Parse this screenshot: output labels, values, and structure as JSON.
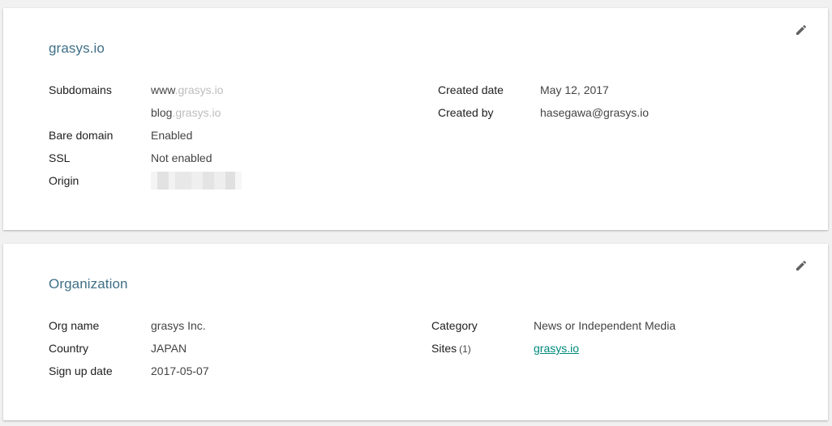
{
  "site": {
    "title": "grasys.io",
    "labels": {
      "subdomains": "Subdomains",
      "bare_domain": "Bare domain",
      "ssl": "SSL",
      "origin": "Origin",
      "created_date": "Created date",
      "created_by": "Created by"
    },
    "subdomains": [
      {
        "prefix": "www",
        "domain": ".grasys.io"
      },
      {
        "prefix": "blog",
        "domain": ".grasys.io"
      }
    ],
    "bare_domain": "Enabled",
    "ssl": "Not enabled",
    "created_date": "May 12, 2017",
    "created_by": "hasegawa@grasys.io"
  },
  "org": {
    "title": "Organization",
    "labels": {
      "org_name": "Org name",
      "country": "Country",
      "sign_up_date": "Sign up date",
      "category": "Category",
      "sites": "Sites"
    },
    "org_name": "grasys Inc.",
    "country": "JAPAN",
    "sign_up_date": "2017-05-07",
    "category": "News or Independent Media",
    "sites_count": "(1)",
    "sites_link": "grasys.io"
  },
  "icons": {
    "edit": "pencil-icon"
  },
  "colors": {
    "title": "#3f6f86",
    "link": "#00897b",
    "background": "#f1f1f1",
    "card": "#ffffff"
  }
}
